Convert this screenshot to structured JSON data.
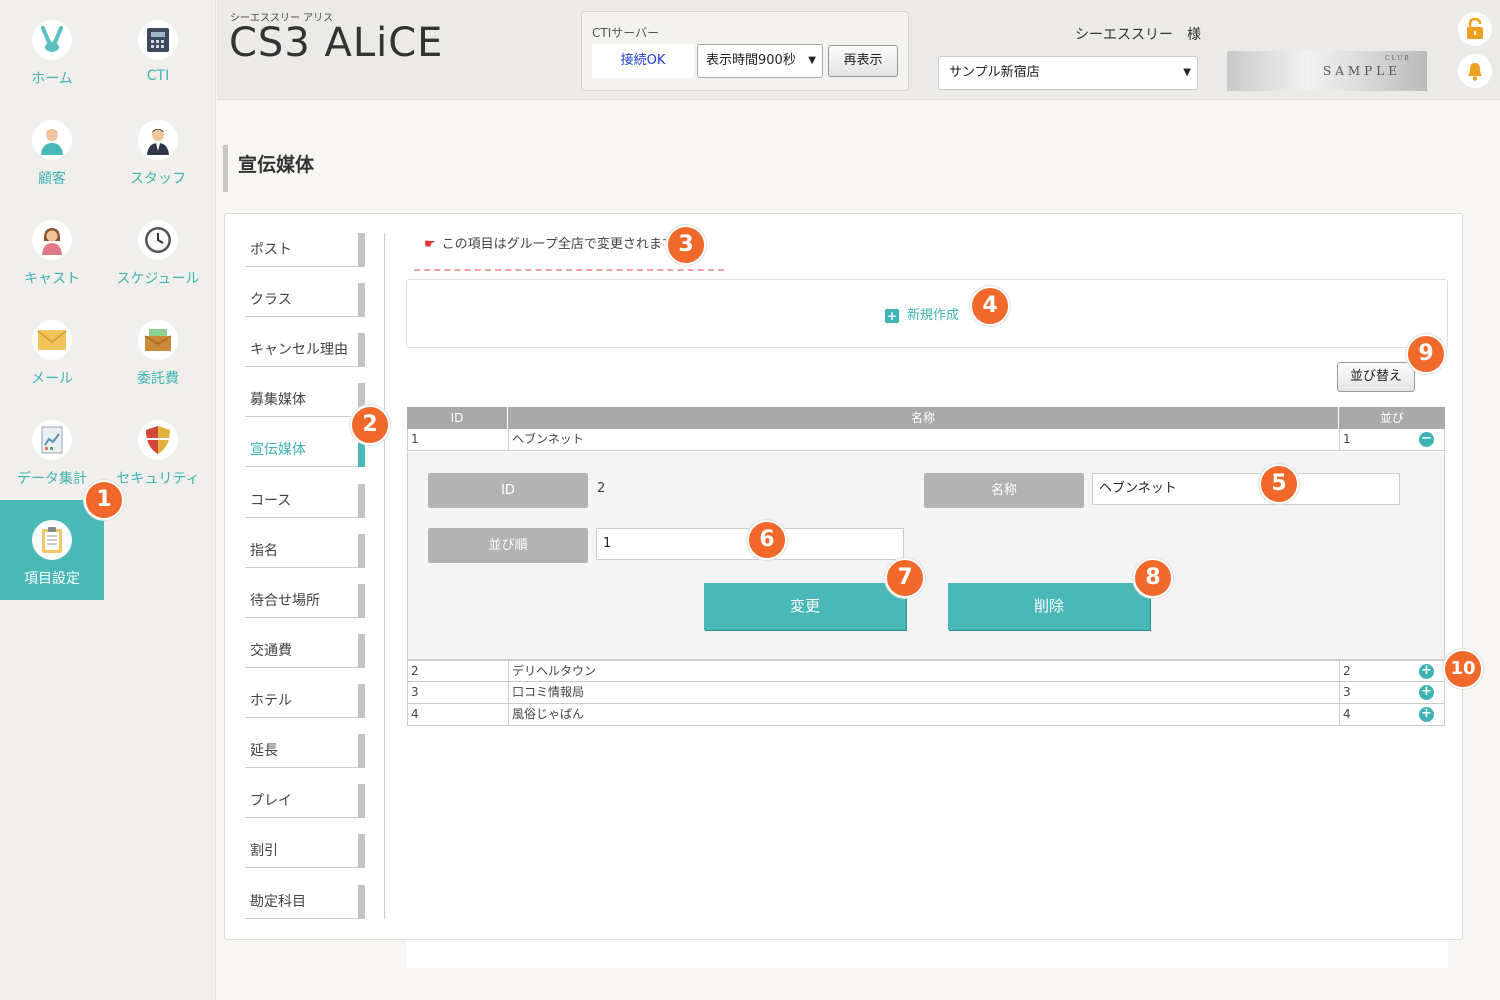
{
  "sidebar": {
    "items": [
      {
        "label": "ホーム",
        "icon": "rabbit-icon"
      },
      {
        "label": "CTI",
        "icon": "phone-icon"
      },
      {
        "label": "顧客",
        "icon": "customer-icon"
      },
      {
        "label": "スタッフ",
        "icon": "staff-icon"
      },
      {
        "label": "キャスト",
        "icon": "cast-icon"
      },
      {
        "label": "スケジュール",
        "icon": "clock-icon"
      },
      {
        "label": "メール",
        "icon": "mail-icon"
      },
      {
        "label": "委託費",
        "icon": "wallet-icon"
      },
      {
        "label": "データ集計",
        "icon": "chart-document-icon"
      },
      {
        "label": "セキュリティ",
        "icon": "shield-icon"
      },
      {
        "label": "項目設定",
        "icon": "clipboard-icon",
        "active": true
      }
    ]
  },
  "header": {
    "brand_sub": "シーエススリー アリス",
    "brand_title": "CS3 ALiCE",
    "cti_label": "CTIサーバー",
    "cti_status": "接続OK",
    "refresh_interval": "表示時間900秒",
    "redisplay_label": "再表示",
    "user_name": "シーエススリー　様",
    "store": "サンプル新宿店",
    "club_logo_small": "CLUB",
    "club_logo_main": "SAMPLE"
  },
  "page": {
    "title": "宣伝媒体"
  },
  "subnav": {
    "items": [
      "ポスト",
      "クラス",
      "キャンセル理由",
      "募集媒体",
      "宣伝媒体",
      "コース",
      "指名",
      "待合せ場所",
      "交通費",
      "ホテル",
      "延長",
      "プレイ",
      "割引",
      "勘定科目"
    ],
    "active_index": 4
  },
  "notice": {
    "text": "この項目はグループ全店で変更されます"
  },
  "new_item": {
    "label": "新規作成"
  },
  "sort_button": {
    "label": "並び替え"
  },
  "table": {
    "columns": [
      "ID",
      "名称",
      "並び"
    ],
    "rows": [
      {
        "id": "1",
        "name": "ヘブンネット",
        "order": "1",
        "expanded": true
      },
      {
        "id": "2",
        "name": "デリヘルタウン",
        "order": "2"
      },
      {
        "id": "3",
        "name": "口コミ情報局",
        "order": "3"
      },
      {
        "id": "4",
        "name": "風俗じゃぱん",
        "order": "4"
      }
    ]
  },
  "edit": {
    "id_label": "ID",
    "id_value": "2",
    "name_label": "名称",
    "name_value": "ヘブンネット",
    "order_label": "並び順",
    "order_value": "1",
    "update_label": "変更",
    "delete_label": "削除"
  },
  "callouts": [
    "1",
    "2",
    "3",
    "4",
    "5",
    "6",
    "7",
    "8",
    "9",
    "10"
  ],
  "colors": {
    "teal": "#4bb8b8",
    "callout": "#f0692a",
    "header_bg": "#eceae6"
  }
}
